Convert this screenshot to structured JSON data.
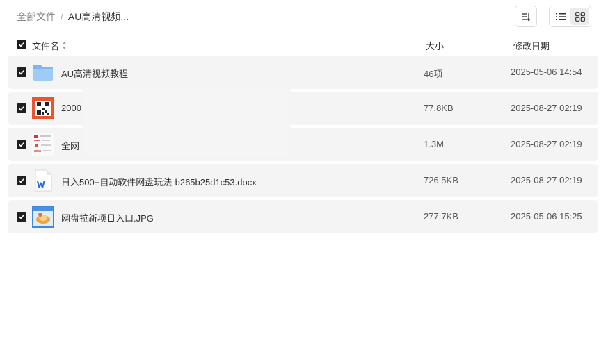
{
  "breadcrumb": {
    "root": "全部文件",
    "separator": "/",
    "current": "AU高清视频..."
  },
  "header": {
    "name": "文件名",
    "size": "大小",
    "date": "修改日期"
  },
  "icons": {
    "sort": "sort-icon",
    "list_view": "list-view-icon",
    "grid_view": "grid-view-icon"
  },
  "files": [
    {
      "name": "AU高清视频教程",
      "size": "46项",
      "date": "2025-05-06 14:54",
      "type": "folder"
    },
    {
      "name": "2000",
      "size": "77.8KB",
      "date": "2025-08-27 02:19",
      "type": "image-qr"
    },
    {
      "name": "全网",
      "size": "1.3M",
      "date": "2025-08-27 02:19",
      "type": "image-doc"
    },
    {
      "name": "日入500+自动软件网盘玩法-b265b25d1c53.docx",
      "size": "726.5KB",
      "date": "2025-08-27 02:19",
      "type": "word"
    },
    {
      "name": "网盘拉新项目入口.JPG",
      "size": "277.7KB",
      "date": "2025-05-06 15:25",
      "type": "image-jpg"
    }
  ]
}
